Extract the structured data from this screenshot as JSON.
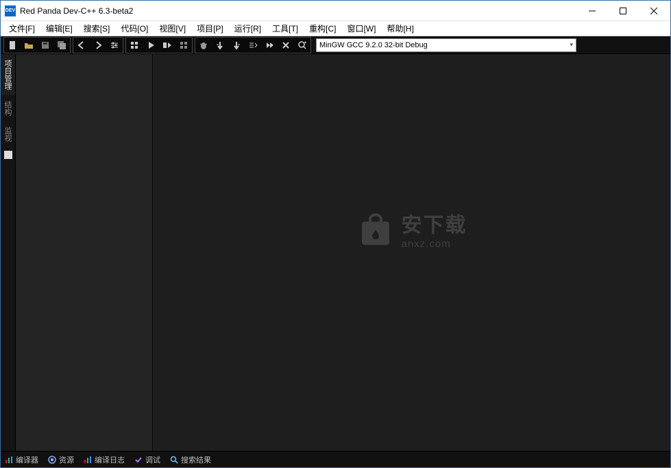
{
  "window": {
    "title": "Red Panda Dev-C++ 6.3-beta2",
    "icon_label": "DEV"
  },
  "menu": {
    "items": [
      "文件[F]",
      "编辑[E]",
      "搜索[S]",
      "代码[O]",
      "视图[V]",
      "项目[P]",
      "运行[R]",
      "工具[T]",
      "重构[C]",
      "窗口[W]",
      "帮助[H]"
    ]
  },
  "toolbar": {
    "buttons": [
      {
        "name": "new-file-icon",
        "group": 0
      },
      {
        "name": "open-folder-icon",
        "group": 0
      },
      {
        "name": "save-icon",
        "group": 0
      },
      {
        "name": "save-all-icon",
        "group": 0
      },
      {
        "name": "back-icon",
        "group": 1
      },
      {
        "name": "forward-icon",
        "group": 1
      },
      {
        "name": "settings-toggle-icon",
        "group": 1
      },
      {
        "name": "compile-icon",
        "group": 2
      },
      {
        "name": "run-icon",
        "group": 2
      },
      {
        "name": "compile-run-icon",
        "group": 2
      },
      {
        "name": "rebuild-icon",
        "group": 2
      },
      {
        "name": "debug-icon",
        "group": 3
      },
      {
        "name": "step-over-icon",
        "group": 3
      },
      {
        "name": "step-into-icon",
        "group": 3
      },
      {
        "name": "step-out-icon",
        "group": 3
      },
      {
        "name": "continue-icon",
        "group": 3
      },
      {
        "name": "stop-debug-icon",
        "group": 3
      },
      {
        "name": "add-watch-icon",
        "group": 3
      }
    ],
    "compiler_selected": "MinGW GCC 9.2.0 32-bit Debug"
  },
  "side_tabs": {
    "items": [
      {
        "label": "项目管理",
        "active": true
      },
      {
        "label": "结构",
        "active": false
      },
      {
        "label": "监视",
        "active": false
      }
    ]
  },
  "watermark": {
    "text_main": "安下载",
    "text_sub": "anxz.com"
  },
  "bottom_tabs": {
    "items": [
      {
        "label": "编译器",
        "icon": "bars-colored"
      },
      {
        "label": "资源",
        "icon": "resource"
      },
      {
        "label": "编译日志",
        "icon": "bars-colored"
      },
      {
        "label": "调试",
        "icon": "check"
      },
      {
        "label": "搜索结果",
        "icon": "search"
      }
    ]
  }
}
